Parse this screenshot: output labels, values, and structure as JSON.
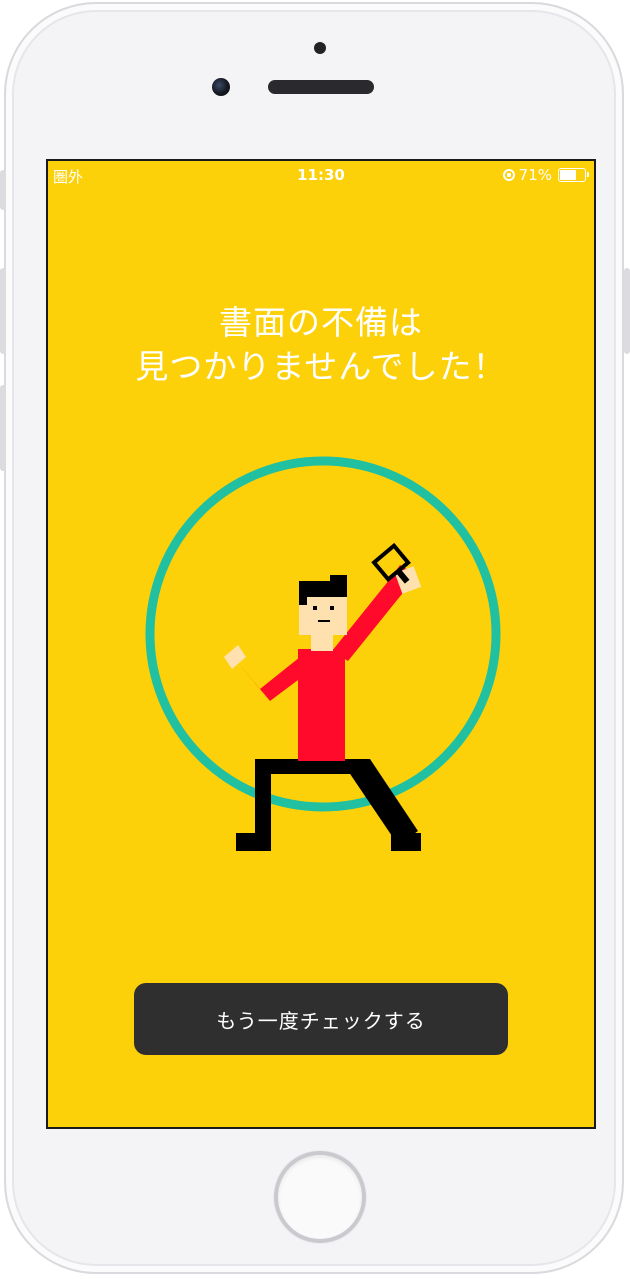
{
  "status_bar": {
    "carrier": "圏外",
    "time": "11:30",
    "battery_percent": "71%",
    "battery_level": 0.71
  },
  "headline": {
    "line1": "書面の不備は",
    "line2": "見つかりませんでした！"
  },
  "button": {
    "label": "もう一度チェックする"
  },
  "colors": {
    "background": "#fdd10a",
    "ring": "#21c0a0",
    "shirt": "#ff0a2a",
    "pants": "#000000",
    "skin": "#ffe1b0",
    "button": "#2f2f2f"
  },
  "icons": {
    "rotation_lock": "rotation-lock-icon",
    "battery": "battery-icon",
    "magnifier": "magnifying-glass-icon"
  }
}
